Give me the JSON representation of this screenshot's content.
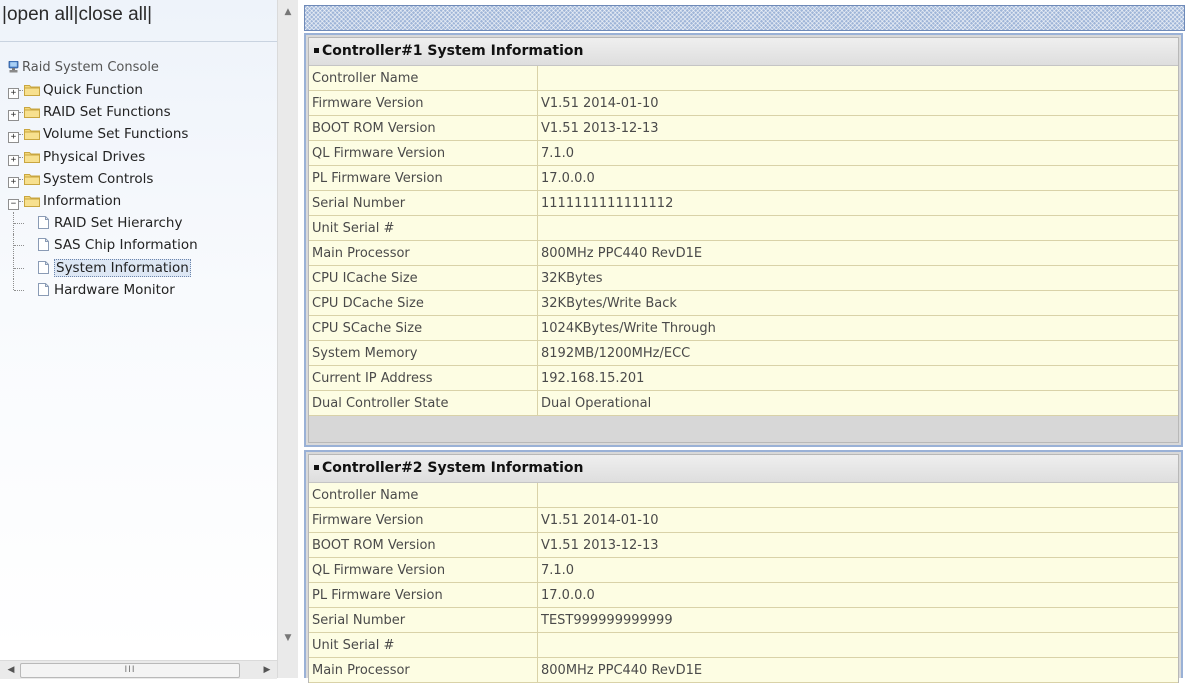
{
  "left_nav": {
    "open_all": "open all",
    "close_all": "close all",
    "sep": "|",
    "root_label": "Raid System Console",
    "folders": [
      {
        "label": "Quick Function",
        "expander": "+"
      },
      {
        "label": "RAID Set Functions",
        "expander": "+"
      },
      {
        "label": "Volume Set Functions",
        "expander": "+"
      },
      {
        "label": "Physical Drives",
        "expander": "+"
      },
      {
        "label": "System Controls",
        "expander": "+"
      },
      {
        "label": "Information",
        "expander": "−"
      }
    ],
    "info_children": [
      {
        "label": "RAID Set Hierarchy",
        "selected": false
      },
      {
        "label": "SAS Chip Information",
        "selected": false
      },
      {
        "label": "System Information",
        "selected": true
      },
      {
        "label": "Hardware Monitor",
        "selected": false
      }
    ],
    "hscroll_grip": "III",
    "icons": {
      "root": "computer-icon",
      "folder": "folder-icon",
      "page": "page-icon"
    }
  },
  "controller1": {
    "title": "Controller#1 System Information",
    "rows": [
      {
        "k": "Controller Name",
        "v": ""
      },
      {
        "k": "Firmware Version",
        "v": "V1.51 2014-01-10"
      },
      {
        "k": "BOOT ROM Version",
        "v": "V1.51 2013-12-13"
      },
      {
        "k": "QL Firmware Version",
        "v": "7.1.0"
      },
      {
        "k": "PL Firmware Version",
        "v": "17.0.0.0"
      },
      {
        "k": "Serial Number",
        "v": "1111111111111112"
      },
      {
        "k": "Unit Serial #",
        "v": ""
      },
      {
        "k": "Main Processor",
        "v": "800MHz PPC440 RevD1E"
      },
      {
        "k": "CPU ICache Size",
        "v": "32KBytes"
      },
      {
        "k": "CPU DCache Size",
        "v": "32KBytes/Write Back"
      },
      {
        "k": "CPU SCache Size",
        "v": "1024KBytes/Write Through"
      },
      {
        "k": "System Memory",
        "v": "8192MB/1200MHz/ECC"
      },
      {
        "k": "Current IP Address",
        "v": "192.168.15.201"
      },
      {
        "k": "Dual Controller State",
        "v": "Dual Operational"
      }
    ]
  },
  "controller2": {
    "title": "Controller#2 System Information",
    "rows": [
      {
        "k": "Controller Name",
        "v": ""
      },
      {
        "k": "Firmware Version",
        "v": "V1.51 2014-01-10"
      },
      {
        "k": "BOOT ROM Version",
        "v": "V1.51 2013-12-13"
      },
      {
        "k": "QL Firmware Version",
        "v": "7.1.0"
      },
      {
        "k": "PL Firmware Version",
        "v": "17.0.0.0"
      },
      {
        "k": "Serial Number",
        "v": "TEST999999999999"
      },
      {
        "k": "Unit Serial #",
        "v": ""
      },
      {
        "k": "Main Processor",
        "v": "800MHz PPC440 RevD1E"
      }
    ]
  },
  "colors": {
    "row_bg": "#fdfde3",
    "row_border": "#d9d2a8",
    "accent": "#9ab1d6",
    "selection": "#dde7f4"
  }
}
